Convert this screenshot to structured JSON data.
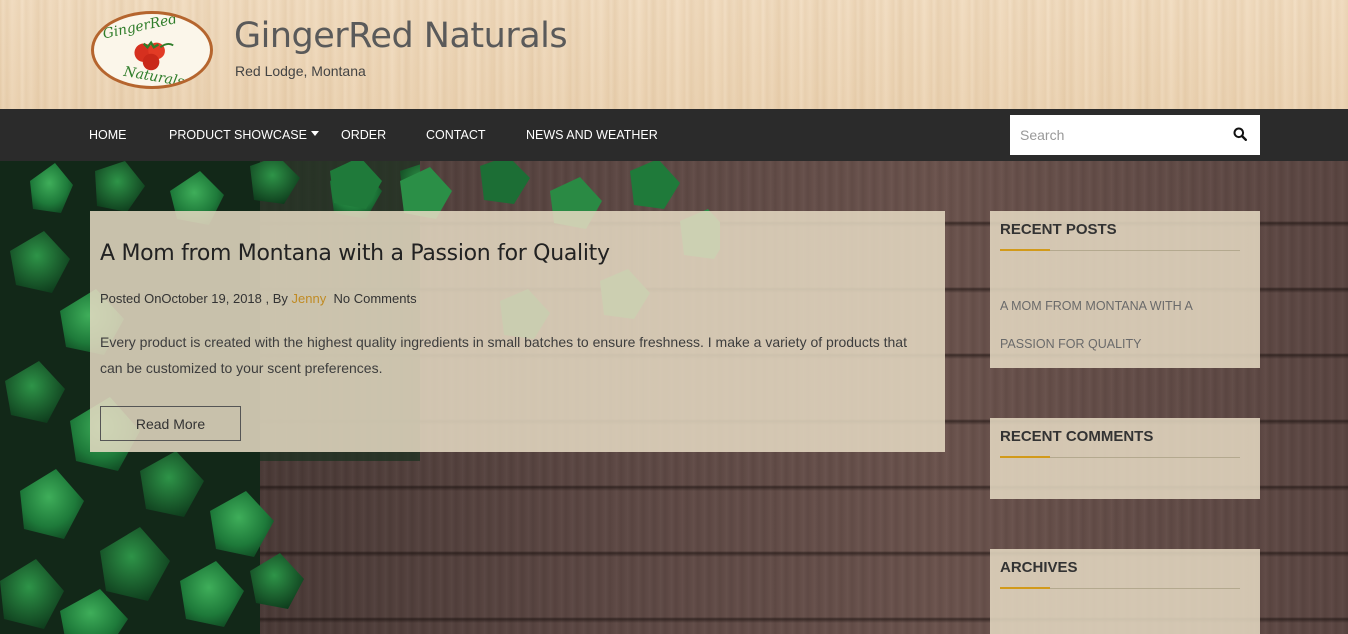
{
  "site": {
    "logo_text_top": "GingerRed",
    "logo_text_bottom": "Naturals",
    "title": "GingerRed Naturals",
    "tagline": "Red Lodge, Montana"
  },
  "nav": {
    "items": [
      "Home",
      "Product Showcase",
      "Order",
      "Contact",
      "News and Weather"
    ],
    "search_placeholder": "Search"
  },
  "post": {
    "title": "A Mom from Montana with a Passion for Quality",
    "posted_on": "Posted OnOctober 19, 2018",
    "by": ", By",
    "author": "Jenny",
    "comments": "No Comments",
    "excerpt": "Every product is created with the highest quality ingredients in small batches to ensure freshness. I make a variety of products that can be customized to your scent preferences.",
    "read_more": "Read More"
  },
  "sidebar": {
    "recent_posts_title": "Recent Posts",
    "recent_posts": [
      "A Mom from Montana with a Passion for Quality"
    ],
    "recent_comments_title": "Recent Comments",
    "archives_title": "Archives"
  },
  "colors": {
    "nav_bg": "#2b2b2b",
    "accent": "#d29a1a",
    "panel": "#e6dbc4",
    "title_text": "#5a5a5a"
  }
}
